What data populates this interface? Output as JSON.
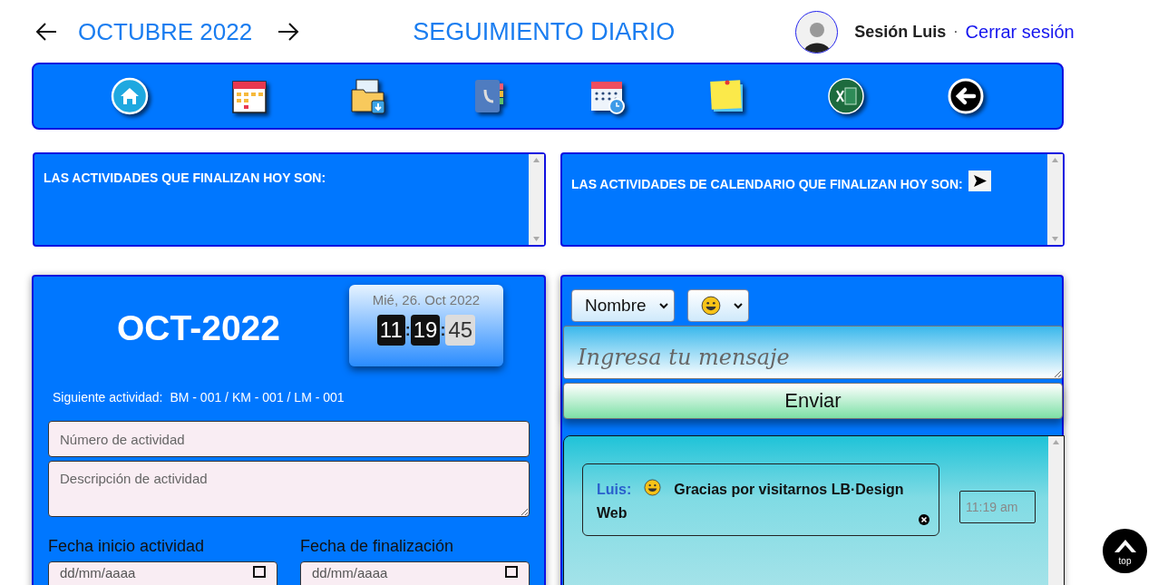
{
  "header": {
    "month": "OCTUBRE 2022",
    "title": "SEGUIMIENTO DIARIO",
    "session": "Sesión Luis",
    "separator": "·",
    "logout": "Cerrar sesión"
  },
  "toolbar": [
    {
      "kind": "home"
    },
    {
      "kind": "calendar"
    },
    {
      "kind": "folder"
    },
    {
      "kind": "contacts"
    },
    {
      "kind": "schedule"
    },
    {
      "kind": "note"
    },
    {
      "kind": "excel"
    },
    {
      "kind": "back"
    }
  ],
  "alerts": [
    {
      "text": "LAS ACTIVIDADES QUE FINALIZAN HOY SON:",
      "has_button": false
    },
    {
      "text": "LAS ACTIVIDADES DE CALENDARIO QUE FINALIZAN HOY SON:",
      "has_button": true
    }
  ],
  "activity_form": {
    "month_label": "OCT-2022",
    "clock": {
      "date": "Mié, 26. Oct 2022",
      "hours": "11",
      "minutes": "19",
      "seconds": "45",
      "separator": ":"
    },
    "next_label": "Siguiente actividad:",
    "next_value": "BM - 001 / KM - 001 / LM - 001",
    "number_placeholder": "Número de actividad",
    "description_placeholder": "Descripción de actividad",
    "start_label": "Fecha inicio actividad",
    "end_label": "Fecha de finalización",
    "start_placeholder": "dd/mm/aaaa",
    "end_placeholder": "dd/mm/aaaa"
  },
  "chat": {
    "name_select": "Nombre",
    "message_placeholder": "Ingresa tu mensaje",
    "send": "Enviar",
    "messages": [
      {
        "author": "Luis:",
        "text": "Gracias por visitarnos LB·Design Web",
        "time": "11:19 am"
      }
    ]
  },
  "top_button": "top"
}
